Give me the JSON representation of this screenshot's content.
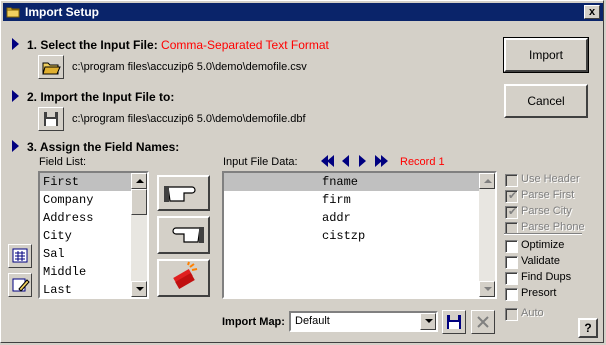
{
  "window": {
    "title": "Import Setup",
    "close_label": "x"
  },
  "step1": {
    "label": "1. Select the Input File:",
    "format": "Comma-Separated Text Format",
    "path": "c:\\program files\\accuzip6 5.0\\demo\\demofile.csv"
  },
  "step2": {
    "label": "2. Import the Input File to:",
    "path": "c:\\program files\\accuzip6 5.0\\demo\\demofile.dbf"
  },
  "step3": {
    "label": "3. Assign the Field Names:"
  },
  "field_list": {
    "label": "Field List:",
    "items": [
      "First",
      "Company",
      "Address",
      "City",
      "Sal",
      "Middle",
      "Last"
    ]
  },
  "input_data": {
    "label": "Input File Data:",
    "record": "Record 1",
    "items": [
      "fname",
      "firm",
      "addr",
      "cistzp"
    ]
  },
  "buttons": {
    "import": "Import",
    "cancel": "Cancel",
    "help": "?"
  },
  "options": [
    {
      "label": "Use Header",
      "checked": false,
      "disabled": true
    },
    {
      "label": "Parse First",
      "checked": true,
      "disabled": true
    },
    {
      "label": "Parse City",
      "checked": true,
      "disabled": true
    },
    {
      "label": "Parse Phone",
      "checked": false,
      "disabled": true
    },
    {
      "label": "Optimize",
      "checked": false,
      "disabled": false
    },
    {
      "label": "Validate",
      "checked": false,
      "disabled": false
    },
    {
      "label": "Find Dups",
      "checked": false,
      "disabled": false
    },
    {
      "label": "Presort",
      "checked": false,
      "disabled": false
    },
    {
      "label": "Auto",
      "checked": false,
      "disabled": true
    }
  ],
  "import_map": {
    "label": "Import Map:",
    "value": "Default"
  },
  "colors": {
    "titlebar": "#0a246a",
    "accent_red": "#ff0000",
    "arrow": "#000080",
    "face": "#d4d0c8"
  }
}
